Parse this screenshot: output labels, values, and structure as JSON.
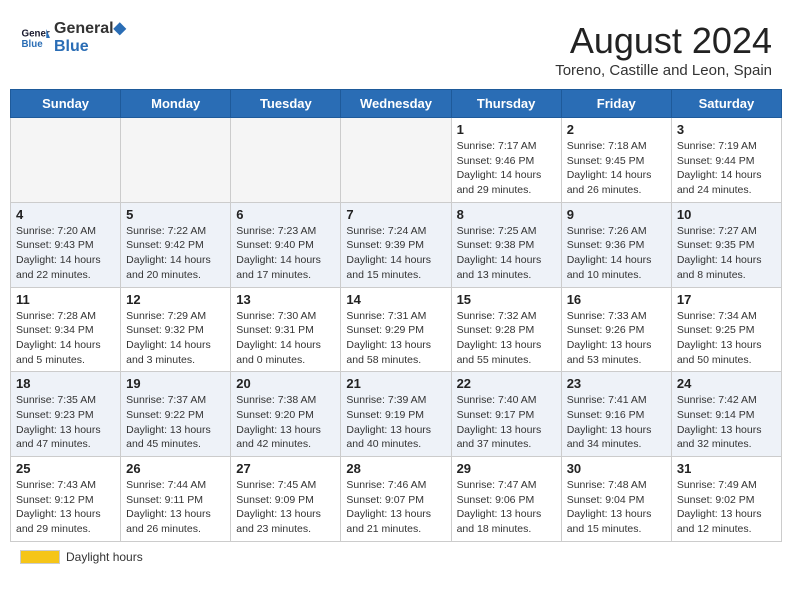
{
  "header": {
    "logo_line1": "General",
    "logo_line2": "Blue",
    "month_year": "August 2024",
    "location": "Toreno, Castille and Leon, Spain"
  },
  "days_of_week": [
    "Sunday",
    "Monday",
    "Tuesday",
    "Wednesday",
    "Thursday",
    "Friday",
    "Saturday"
  ],
  "weeks": [
    [
      {
        "day": "",
        "info": ""
      },
      {
        "day": "",
        "info": ""
      },
      {
        "day": "",
        "info": ""
      },
      {
        "day": "",
        "info": ""
      },
      {
        "day": "1",
        "info": "Sunrise: 7:17 AM\nSunset: 9:46 PM\nDaylight: 14 hours\nand 29 minutes."
      },
      {
        "day": "2",
        "info": "Sunrise: 7:18 AM\nSunset: 9:45 PM\nDaylight: 14 hours\nand 26 minutes."
      },
      {
        "day": "3",
        "info": "Sunrise: 7:19 AM\nSunset: 9:44 PM\nDaylight: 14 hours\nand 24 minutes."
      }
    ],
    [
      {
        "day": "4",
        "info": "Sunrise: 7:20 AM\nSunset: 9:43 PM\nDaylight: 14 hours\nand 22 minutes."
      },
      {
        "day": "5",
        "info": "Sunrise: 7:22 AM\nSunset: 9:42 PM\nDaylight: 14 hours\nand 20 minutes."
      },
      {
        "day": "6",
        "info": "Sunrise: 7:23 AM\nSunset: 9:40 PM\nDaylight: 14 hours\nand 17 minutes."
      },
      {
        "day": "7",
        "info": "Sunrise: 7:24 AM\nSunset: 9:39 PM\nDaylight: 14 hours\nand 15 minutes."
      },
      {
        "day": "8",
        "info": "Sunrise: 7:25 AM\nSunset: 9:38 PM\nDaylight: 14 hours\nand 13 minutes."
      },
      {
        "day": "9",
        "info": "Sunrise: 7:26 AM\nSunset: 9:36 PM\nDaylight: 14 hours\nand 10 minutes."
      },
      {
        "day": "10",
        "info": "Sunrise: 7:27 AM\nSunset: 9:35 PM\nDaylight: 14 hours\nand 8 minutes."
      }
    ],
    [
      {
        "day": "11",
        "info": "Sunrise: 7:28 AM\nSunset: 9:34 PM\nDaylight: 14 hours\nand 5 minutes."
      },
      {
        "day": "12",
        "info": "Sunrise: 7:29 AM\nSunset: 9:32 PM\nDaylight: 14 hours\nand 3 minutes."
      },
      {
        "day": "13",
        "info": "Sunrise: 7:30 AM\nSunset: 9:31 PM\nDaylight: 14 hours\nand 0 minutes."
      },
      {
        "day": "14",
        "info": "Sunrise: 7:31 AM\nSunset: 9:29 PM\nDaylight: 13 hours\nand 58 minutes."
      },
      {
        "day": "15",
        "info": "Sunrise: 7:32 AM\nSunset: 9:28 PM\nDaylight: 13 hours\nand 55 minutes."
      },
      {
        "day": "16",
        "info": "Sunrise: 7:33 AM\nSunset: 9:26 PM\nDaylight: 13 hours\nand 53 minutes."
      },
      {
        "day": "17",
        "info": "Sunrise: 7:34 AM\nSunset: 9:25 PM\nDaylight: 13 hours\nand 50 minutes."
      }
    ],
    [
      {
        "day": "18",
        "info": "Sunrise: 7:35 AM\nSunset: 9:23 PM\nDaylight: 13 hours\nand 47 minutes."
      },
      {
        "day": "19",
        "info": "Sunrise: 7:37 AM\nSunset: 9:22 PM\nDaylight: 13 hours\nand 45 minutes."
      },
      {
        "day": "20",
        "info": "Sunrise: 7:38 AM\nSunset: 9:20 PM\nDaylight: 13 hours\nand 42 minutes."
      },
      {
        "day": "21",
        "info": "Sunrise: 7:39 AM\nSunset: 9:19 PM\nDaylight: 13 hours\nand 40 minutes."
      },
      {
        "day": "22",
        "info": "Sunrise: 7:40 AM\nSunset: 9:17 PM\nDaylight: 13 hours\nand 37 minutes."
      },
      {
        "day": "23",
        "info": "Sunrise: 7:41 AM\nSunset: 9:16 PM\nDaylight: 13 hours\nand 34 minutes."
      },
      {
        "day": "24",
        "info": "Sunrise: 7:42 AM\nSunset: 9:14 PM\nDaylight: 13 hours\nand 32 minutes."
      }
    ],
    [
      {
        "day": "25",
        "info": "Sunrise: 7:43 AM\nSunset: 9:12 PM\nDaylight: 13 hours\nand 29 minutes."
      },
      {
        "day": "26",
        "info": "Sunrise: 7:44 AM\nSunset: 9:11 PM\nDaylight: 13 hours\nand 26 minutes."
      },
      {
        "day": "27",
        "info": "Sunrise: 7:45 AM\nSunset: 9:09 PM\nDaylight: 13 hours\nand 23 minutes."
      },
      {
        "day": "28",
        "info": "Sunrise: 7:46 AM\nSunset: 9:07 PM\nDaylight: 13 hours\nand 21 minutes."
      },
      {
        "day": "29",
        "info": "Sunrise: 7:47 AM\nSunset: 9:06 PM\nDaylight: 13 hours\nand 18 minutes."
      },
      {
        "day": "30",
        "info": "Sunrise: 7:48 AM\nSunset: 9:04 PM\nDaylight: 13 hours\nand 15 minutes."
      },
      {
        "day": "31",
        "info": "Sunrise: 7:49 AM\nSunset: 9:02 PM\nDaylight: 13 hours\nand 12 minutes."
      }
    ]
  ],
  "footer": {
    "daylight_label": "Daylight hours"
  }
}
